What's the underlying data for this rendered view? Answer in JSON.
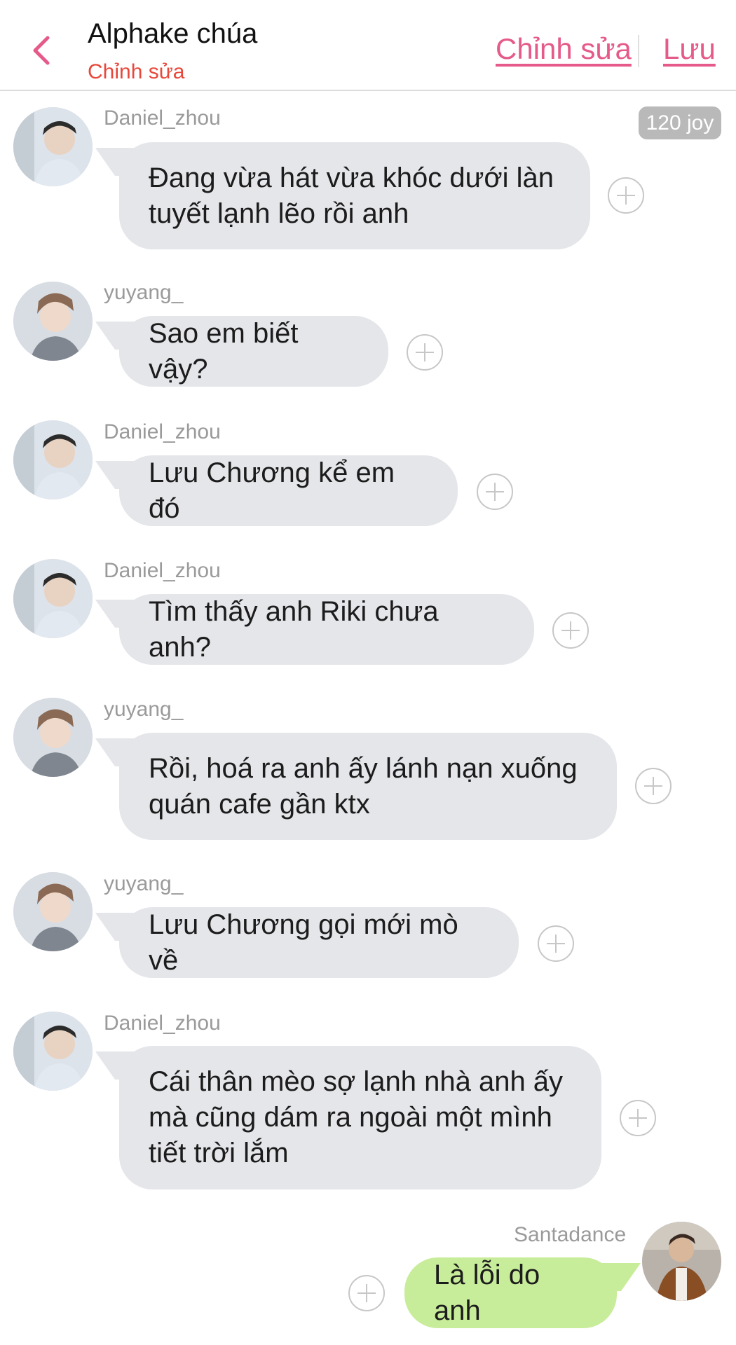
{
  "header": {
    "title": "Alphake chúa",
    "subtitle": "Chỉnh sửa",
    "edit_label": "Chỉnh sửa",
    "save_label": "Lưu",
    "accent_color": "#e55a8a",
    "subtitle_color": "#e8483a"
  },
  "joy_badge": "120 joy",
  "messages": [
    {
      "user": "Daniel_zhou",
      "text": "Đang vừa hát vừa khóc dưới làn\ntuyết lạnh lẽo rồi anh",
      "side": "left"
    },
    {
      "user": "yuyang_",
      "text": "Sao em biết vậy?",
      "side": "left"
    },
    {
      "user": "Daniel_zhou",
      "text": "Lưu Chương kể em đó",
      "side": "left"
    },
    {
      "user": "Daniel_zhou",
      "text": "Tìm thấy anh Riki chưa anh?",
      "side": "left"
    },
    {
      "user": "yuyang_",
      "text": "Rồi, hoá ra anh ấy lánh nạn xuống\nquán cafe gần ktx",
      "side": "left"
    },
    {
      "user": "yuyang_",
      "text": "Lưu Chương gọi mới mò về",
      "side": "left"
    },
    {
      "user": "Daniel_zhou",
      "text": "Cái thân mèo sợ lạnh nhà anh ấy\nmà cũng dám ra ngoài một mình\ntiết trời lắm",
      "side": "left"
    },
    {
      "user": "Santadance",
      "text": "Là lỗi do anh",
      "side": "right"
    }
  ],
  "icons": {
    "back": "chevron-left-icon",
    "add": "plus-circle-icon"
  },
  "colors": {
    "bubble_other": "#e5e6ea",
    "bubble_me": "#c8ed9a"
  }
}
